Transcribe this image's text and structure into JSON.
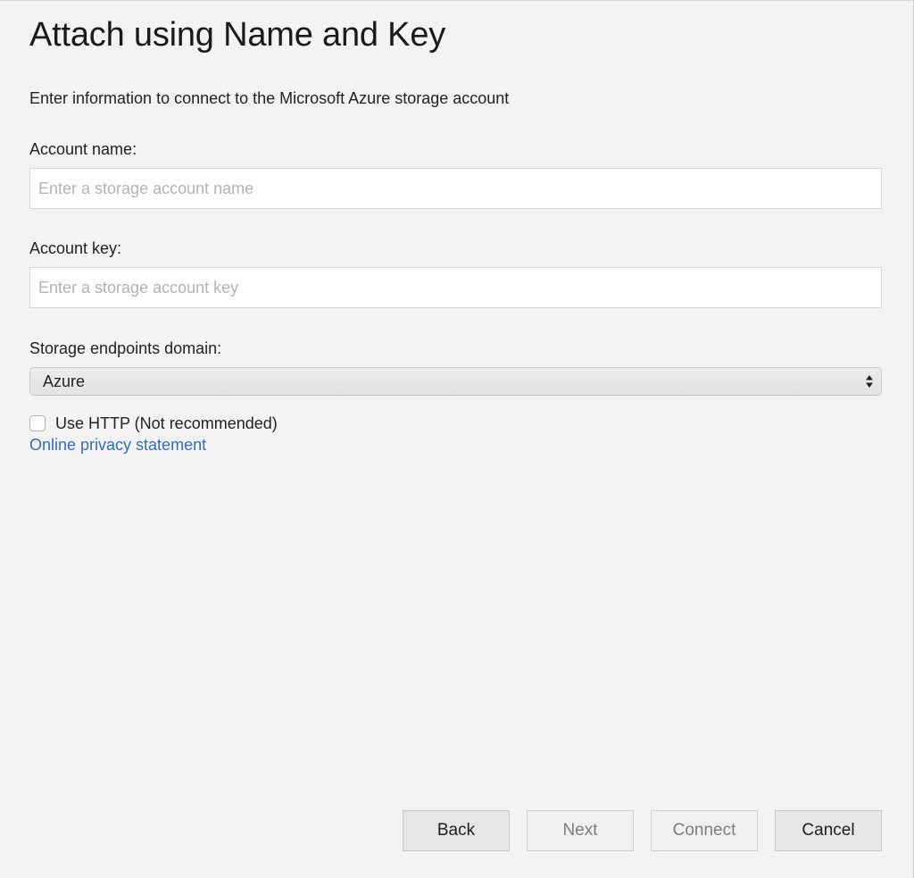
{
  "dialog": {
    "title": "Attach using Name and Key",
    "subtitle": "Enter information to connect to the Microsoft Azure storage account"
  },
  "account_name": {
    "label": "Account name:",
    "value": "",
    "placeholder": "Enter a storage account name"
  },
  "account_key": {
    "label": "Account key:",
    "value": "",
    "placeholder": "Enter a storage account key"
  },
  "endpoints": {
    "label": "Storage endpoints domain:",
    "selected": "Azure"
  },
  "use_http": {
    "label": "Use HTTP (Not recommended)",
    "checked": false
  },
  "privacy_link": "Online privacy statement",
  "buttons": {
    "back": "Back",
    "next": "Next",
    "connect": "Connect",
    "cancel": "Cancel"
  },
  "icons": {
    "select_arrows": "up-down-chevron-icon"
  },
  "colors": {
    "link": "#2f6ec2",
    "background": "#f3f3f3"
  }
}
